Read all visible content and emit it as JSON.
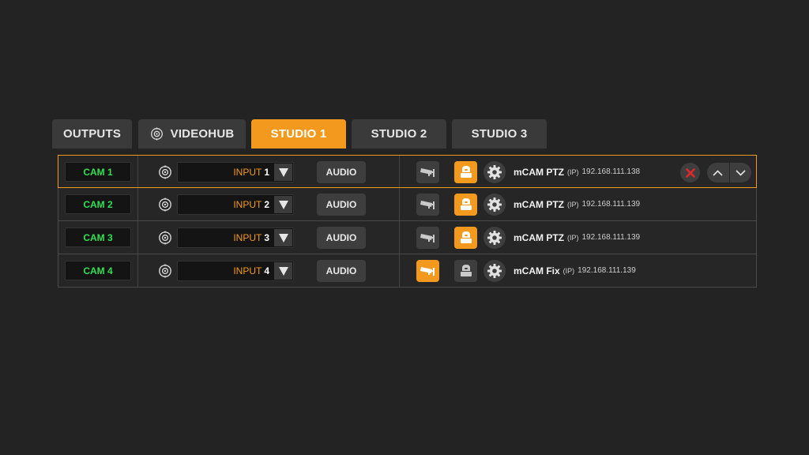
{
  "colors": {
    "accent": "#f39a1e",
    "cam_label": "#2ee052",
    "background": "#232323",
    "delete": "#e0282b"
  },
  "tabs": [
    {
      "label": "OUTPUTS",
      "active": false,
      "icon": null
    },
    {
      "label": "VIDEOHUB",
      "active": false,
      "icon": "target-icon"
    },
    {
      "label": "STUDIO 1",
      "active": true,
      "icon": null
    },
    {
      "label": "STUDIO 2",
      "active": false,
      "icon": null
    },
    {
      "label": "STUDIO 3",
      "active": false,
      "icon": null
    }
  ],
  "rows": [
    {
      "cam": "CAM 1",
      "input_label": "INPUT",
      "input_num": "1",
      "audio": "AUDIO",
      "camera_active": false,
      "ptz_active": true,
      "device_name": "mCAM PTZ",
      "protocol": "(IP)",
      "ip": "192.168.111.138",
      "selected": true
    },
    {
      "cam": "CAM 2",
      "input_label": "INPUT",
      "input_num": "2",
      "audio": "AUDIO",
      "camera_active": false,
      "ptz_active": true,
      "device_name": "mCAM PTZ",
      "protocol": "(IP)",
      "ip": "192.168.111.139",
      "selected": false
    },
    {
      "cam": "CAM 3",
      "input_label": "INPUT",
      "input_num": "3",
      "audio": "AUDIO",
      "camera_active": false,
      "ptz_active": true,
      "device_name": "mCAM PTZ",
      "protocol": "(IP)",
      "ip": "192.168.111.139",
      "selected": false
    },
    {
      "cam": "CAM 4",
      "input_label": "INPUT",
      "input_num": "4",
      "audio": "AUDIO",
      "camera_active": true,
      "ptz_active": false,
      "device_name": "mCAM Fix",
      "protocol": "(IP)",
      "ip": "192.168.111.139",
      "selected": false
    }
  ],
  "icons": {
    "input_source": "target-icon",
    "dropdown": "triangle-down-icon",
    "camera": "security-camera-icon",
    "ptz": "ptz-camera-icon",
    "settings": "gear-icon",
    "delete": "close-icon",
    "move_up": "chevron-up-icon",
    "move_down": "chevron-down-icon"
  }
}
